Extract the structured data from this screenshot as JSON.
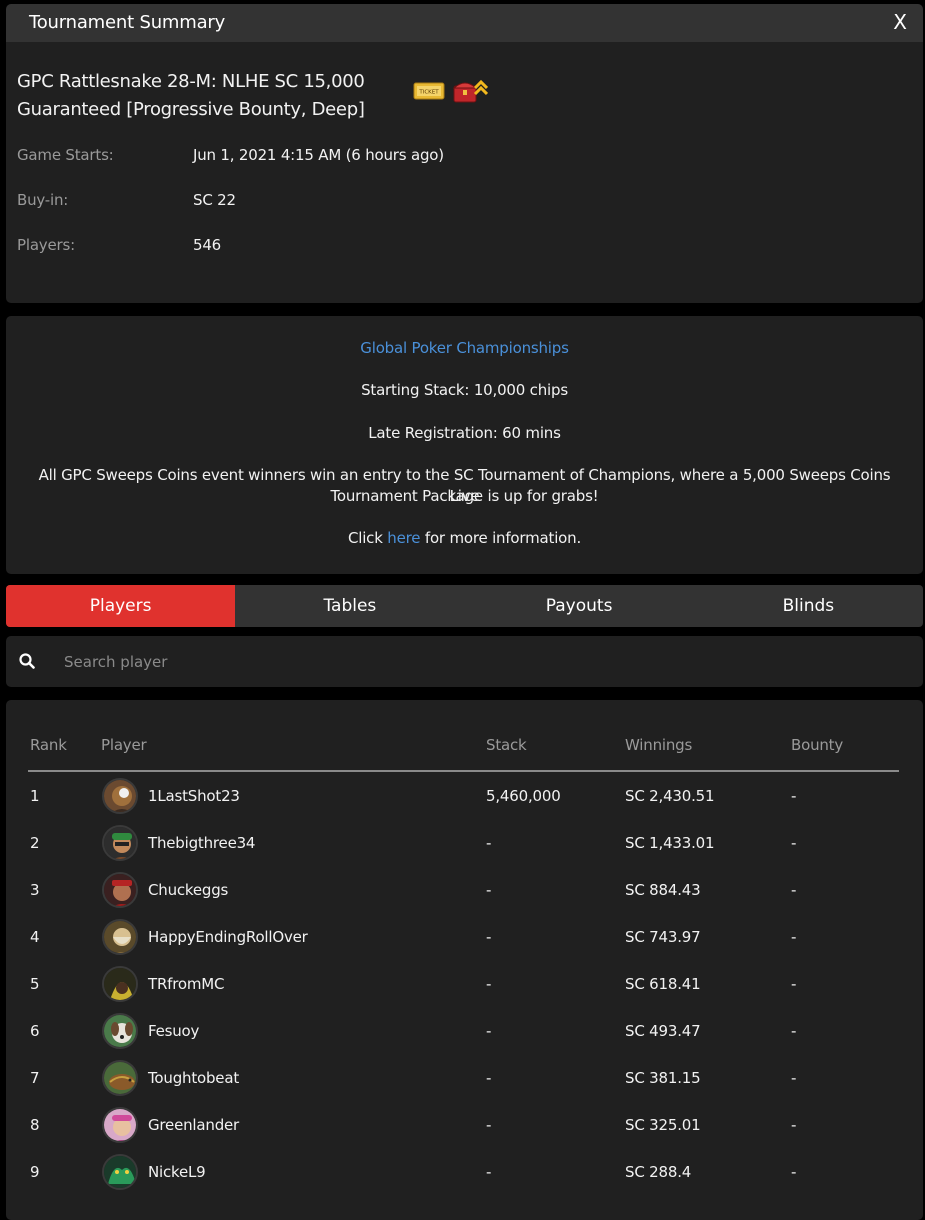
{
  "header": {
    "title": "Tournament Summary",
    "close_label": "X"
  },
  "summary": {
    "name_line1": "GPC Rattlesnake 28-M: NLHE SC 15,000",
    "name_line2": "Guaranteed [Progressive Bounty, Deep]",
    "ticket_label": "TICKET",
    "badges": [
      "ticket-icon",
      "bounty-chest-icon"
    ],
    "rows": [
      {
        "label": "Game Starts:",
        "value": "Jun 1, 2021 4:15 AM (6 hours ago)"
      },
      {
        "label": "Buy-in:",
        "value": "SC 22"
      },
      {
        "label": "Players:",
        "value": "546"
      }
    ]
  },
  "description": {
    "series_link": "Global Poker Championships",
    "starting_stack": "Starting Stack: 10,000 chips",
    "late_reg": "Late Registration: 60 mins",
    "promo_line1": "All GPC Sweeps Coins event winners win an entry to the SC Tournament of Champions, where a 5,000 Sweeps Coins Live",
    "promo_line2": "Tournament Package is up for grabs!",
    "click_prefix": "Click ",
    "click_link": "here",
    "click_suffix": " for more information."
  },
  "tabs": [
    {
      "label": "Players",
      "active": true
    },
    {
      "label": "Tables",
      "active": false
    },
    {
      "label": "Payouts",
      "active": false
    },
    {
      "label": "Blinds",
      "active": false
    }
  ],
  "search": {
    "placeholder": "Search player",
    "value": ""
  },
  "table": {
    "headers": {
      "rank": "Rank",
      "player": "Player",
      "stack": "Stack",
      "winnings": "Winnings",
      "bounty": "Bounty"
    },
    "rows": [
      {
        "rank": "1",
        "player": "1LastShot23",
        "stack": "5,460,000",
        "winnings": "SC 2,430.51",
        "bounty": "-"
      },
      {
        "rank": "2",
        "player": "Thebigthree34",
        "stack": "-",
        "winnings": "SC 1,433.01",
        "bounty": "-"
      },
      {
        "rank": "3",
        "player": "Chuckeggs",
        "stack": "-",
        "winnings": "SC 884.43",
        "bounty": "-"
      },
      {
        "rank": "4",
        "player": "HappyEndingRollOver",
        "stack": "-",
        "winnings": "SC 743.97",
        "bounty": "-"
      },
      {
        "rank": "5",
        "player": "TRfromMC",
        "stack": "-",
        "winnings": "SC 618.41",
        "bounty": "-"
      },
      {
        "rank": "6",
        "player": "Fesuoy",
        "stack": "-",
        "winnings": "SC 493.47",
        "bounty": "-"
      },
      {
        "rank": "7",
        "player": "Toughtobeat",
        "stack": "-",
        "winnings": "SC 381.15",
        "bounty": "-"
      },
      {
        "rank": "8",
        "player": "Greenlander",
        "stack": "-",
        "winnings": "SC 325.01",
        "bounty": "-"
      },
      {
        "rank": "9",
        "player": "NickeL9",
        "stack": "-",
        "winnings": "SC 288.4",
        "bounty": "-"
      }
    ]
  },
  "colors": {
    "accent": "#e0322e",
    "link": "#4a90d9",
    "panel": "#202020",
    "header": "#333333"
  }
}
